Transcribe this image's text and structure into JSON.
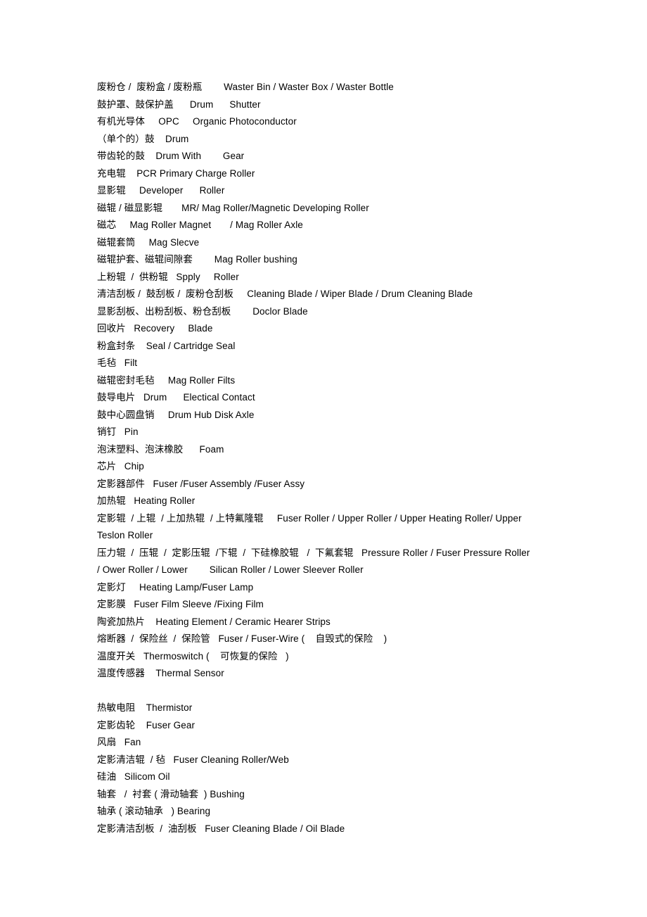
{
  "document": {
    "type": "glossary",
    "title": "Printer Consumable Parts Bilingual Glossary",
    "lines": [
      "废粉仓 /  废粉盒 / 废粉瓶        Waster Bin / Waster Box / Waster Bottle",
      "鼓护罩、鼓保护盖      Drum      Shutter",
      "有机光导体     OPC     Organic Photoconductor",
      "（单个的）鼓    Drum",
      "带齿轮的鼓    Drum With        Gear",
      "充电辊    PCR Primary Charge Roller",
      "显影辊     Developer      Roller",
      "磁辊 / 磁显影辊       MR/ Mag Roller/Magnetic Developing Roller",
      "磁芯     Mag Roller Magnet       / Mag Roller Axle",
      "磁辊套筒     Mag Slecve",
      "磁辊护套、磁辊间隙套        Mag Roller bushing",
      "上粉辊  /  供粉辊   Spply     Roller",
      "清洁刮板 /  鼓刮板 /  废粉仓刮板     Cleaning Blade / Wiper Blade / Drum Cleaning Blade",
      "显影刮板、出粉刮板、粉仓刮板        Doclor Blade",
      "回收片   Recovery     Blade",
      "粉盒封条    Seal / Cartridge Seal",
      "毛毡   Filt",
      "磁辊密封毛毡     Mag Roller Filts",
      "鼓导电片   Drum      Electical Contact",
      "鼓中心圆盘销     Drum Hub Disk Axle",
      "销钉   Pin",
      "泡沫塑料、泡沫橡胶      Foam",
      "芯片   Chip",
      "定影器部件   Fuser /Fuser Assembly /Fuser Assy",
      "加热辊   Heating Roller",
      "定影辊  / 上辊  / 上加热辊  / 上特氟隆辊     Fuser Roller / Upper Roller / Upper Heating Roller/ Upper Teslon Roller",
      "压力辊  /  压辊  /  定影压辊  /下辊  /  下硅橡胶辊   /  下氟套辊   Pressure Roller / Fuser Pressure Roller / Ower Roller / Lower        Silican Roller / Lower Sleever Roller",
      "定影灯     Heating Lamp/Fuser Lamp",
      "定影膜   Fuser Film Sleeve /Fixing Film",
      "陶瓷加热片    Heating Element / Ceramic Hearer Strips",
      "熔断器  /  保险丝  /  保险管   Fuser / Fuser-Wire (    自毁式的保险    )",
      "温度开关   Thermoswitch (    可恢复的保险   )",
      "温度传感器    Thermal Sensor",
      "",
      "热敏电阻    Thermistor",
      "定影齿轮    Fuser Gear",
      "风扇   Fan",
      "定影清洁辊  / 毡   Fuser Cleaning Roller/Web",
      "硅油   Silicom Oil",
      "轴套   /  衬套 ( 滑动轴套  ) Bushing",
      "轴承 ( 滚动轴承   ) Bearing",
      "定影清洁刮板  /  油刮板   Fuser Cleaning Blade / Oil Blade"
    ]
  }
}
